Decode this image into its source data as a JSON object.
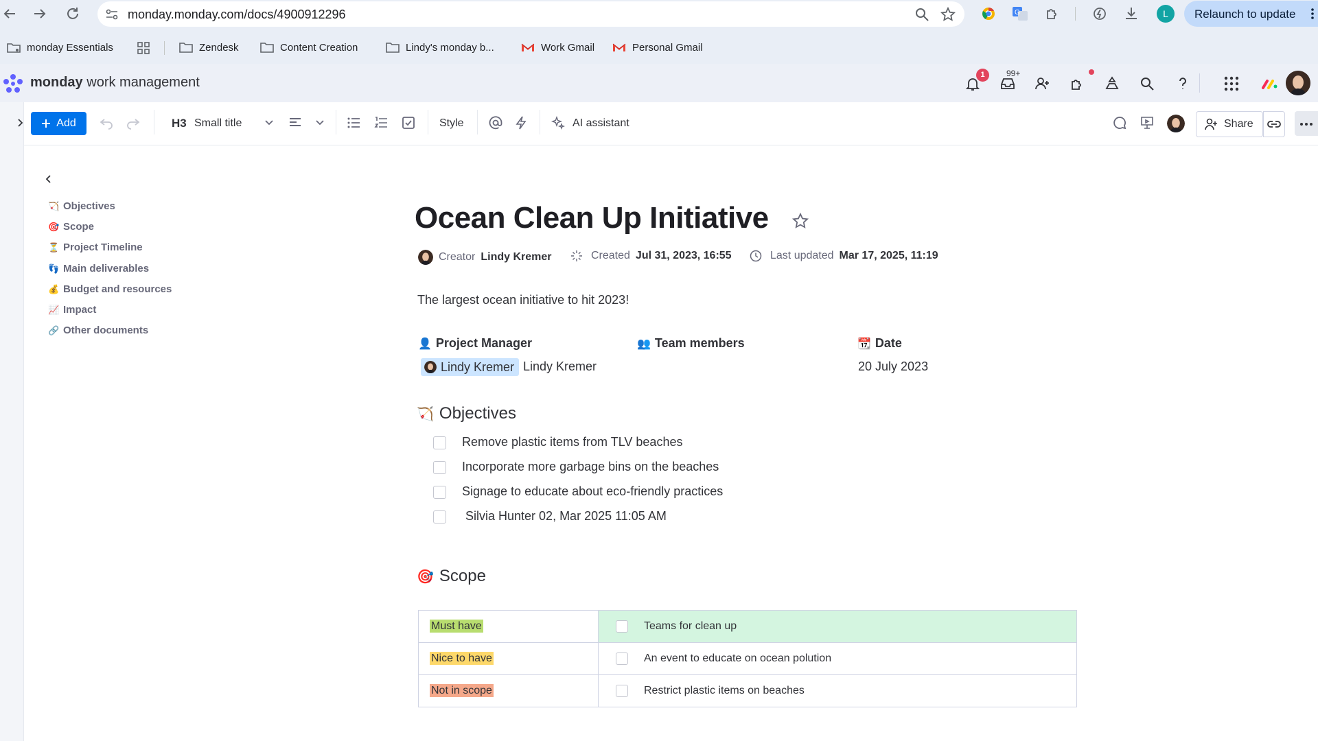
{
  "browser": {
    "url": "monday.monday.com/docs/4900912296",
    "relaunch_label": "Relaunch to update",
    "profile_initial": "L",
    "bookmarks": [
      {
        "label": "monday Essentials",
        "icon": "bookmark-folder-icon"
      },
      {
        "label": "Zendesk",
        "icon": "folder-icon"
      },
      {
        "label": "Content Creation",
        "icon": "folder-icon"
      },
      {
        "label": "Lindy's monday b...",
        "icon": "folder-icon"
      },
      {
        "label": "Work Gmail",
        "icon": "gmail-icon"
      },
      {
        "label": "Personal Gmail",
        "icon": "gmail-icon"
      }
    ]
  },
  "app": {
    "brand_bold": "monday",
    "brand_rest": "work management",
    "notifications_count": "1",
    "inbox_count": "99+"
  },
  "toolbar": {
    "add_label": "Add",
    "heading_icon_label": "H3",
    "heading_style_label": "Small title",
    "style_label": "Style",
    "ai_label": "AI assistant",
    "share_label": "Share"
  },
  "outline": {
    "items": [
      {
        "emoji": "🏹",
        "label": "Objectives"
      },
      {
        "emoji": "🎯",
        "label": "Scope"
      },
      {
        "emoji": "⏳",
        "label": "Project Timeline"
      },
      {
        "emoji": "👣",
        "label": "Main deliverables"
      },
      {
        "emoji": "💰",
        "label": "Budget and resources"
      },
      {
        "emoji": "📈",
        "label": "Impact"
      },
      {
        "emoji": "🔗",
        "label": "Other documents"
      }
    ]
  },
  "doc": {
    "title": "Ocean Clean Up Initiative",
    "creator_label": "Creator",
    "creator_name": "Lindy Kremer",
    "created_label": "Created",
    "created_value": "Jul 31, 2023, 16:55",
    "updated_label": "Last updated",
    "updated_value": "Mar 17, 2025, 11:19",
    "description": "The largest ocean initiative to hit 2023!",
    "columns": {
      "pm": {
        "emoji": "👤",
        "label": "Project Manager"
      },
      "team": {
        "emoji": "👥",
        "label": "Team members"
      },
      "date": {
        "emoji": "📆",
        "label": "Date"
      }
    },
    "pm_chip": "Lindy Kremer",
    "pm_plain": "Lindy Kremer",
    "date_value": "20 July 2023",
    "objectives": {
      "emoji": "🏹",
      "heading": "Objectives",
      "items": [
        "Remove plastic items from TLV beaches",
        "Incorporate more garbage bins on the beaches",
        "Signage to educate about eco-friendly practices",
        " Silvia Hunter 02, Mar 2025 11:05 AM"
      ]
    },
    "scope": {
      "emoji": "🎯",
      "heading": "Scope",
      "rows": [
        {
          "key": "Must have",
          "key_color": "#b8dd6f",
          "value": "Teams for clean up"
        },
        {
          "key": "Nice to have",
          "key_color": "#fdd86a",
          "value": "An event to educate on ocean polution"
        },
        {
          "key": "Not in scope",
          "key_color": "#f5a88a",
          "value": "Restrict plastic items on beaches"
        }
      ]
    }
  }
}
